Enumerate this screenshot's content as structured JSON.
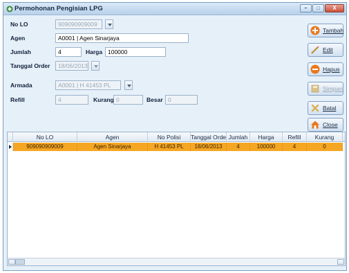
{
  "window": {
    "title": "Permohonan Pengisian LPG",
    "controls": [
      "–",
      "□",
      "X"
    ]
  },
  "form": {
    "no_lo_label": "No LO",
    "no_lo_value": "909090909009",
    "agen_label": "Agen",
    "agen_value": "A0001 | Agen Sinarjaya",
    "jumlah_label": "Jumlah",
    "jumlah_value": "4",
    "harga_label": "Harga",
    "harga_value": "100000",
    "tanggal_label": "Tanggal Order",
    "tanggal_value": "18/06/2013",
    "armada_label": "Armada",
    "armada_value": "A0001 | H 41453 PL",
    "refill_label": "Refill",
    "refill_value": "4",
    "kurang_label": "Kurang",
    "kurang_value": "0",
    "besar_label": "Besar",
    "besar_value": "0"
  },
  "actions": {
    "tambah": "Tambah",
    "edit": "Edit",
    "hapus": "Hapus",
    "simpan": "Simpan",
    "batal": "Batal",
    "close": "Close"
  },
  "colors": {
    "tambah_icon": "#e8791f",
    "hapus_icon": "#e8791f",
    "selected_row": "#f5a623"
  },
  "grid": {
    "columns": [
      "No LO",
      "Agen",
      "No Polisi",
      "Tanggal Order",
      "Jumlah",
      "Harga",
      "Refill",
      "Kurang"
    ],
    "rows": [
      [
        "909090909009",
        "Agen Sinarjaya",
        "H 41453 PL",
        "18/06/2013",
        "4",
        "100000",
        "4",
        "0"
      ]
    ]
  }
}
